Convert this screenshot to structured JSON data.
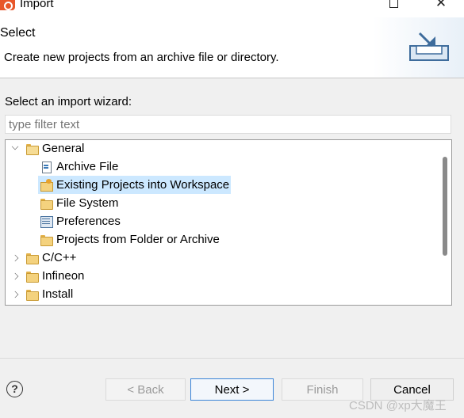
{
  "window": {
    "title": "Import",
    "minimize": "—",
    "close": "✕"
  },
  "header": {
    "title": "Select",
    "description": "Create new projects from an archive file or directory."
  },
  "wizard": {
    "label": "Select an import wizard:",
    "filter_placeholder": "type filter text",
    "tree": [
      {
        "label": "General",
        "expanded": true,
        "level": 0,
        "icon": "folder-open-icon"
      },
      {
        "label": "Archive File",
        "level": 1,
        "icon": "archive-file-icon"
      },
      {
        "label": "Existing Projects into Workspace",
        "level": 1,
        "icon": "project-folder-icon",
        "selected": true
      },
      {
        "label": "File System",
        "level": 1,
        "icon": "folder-icon"
      },
      {
        "label": "Preferences",
        "level": 1,
        "icon": "preferences-icon"
      },
      {
        "label": "Projects from Folder or Archive",
        "level": 1,
        "icon": "folder-icon"
      },
      {
        "label": "C/C++",
        "expanded": false,
        "level": 0,
        "icon": "folder-icon"
      },
      {
        "label": "Infineon",
        "expanded": false,
        "level": 0,
        "icon": "folder-icon"
      },
      {
        "label": "Install",
        "expanded": false,
        "level": 0,
        "icon": "folder-icon"
      }
    ]
  },
  "buttons": {
    "help": "?",
    "back": "< Back",
    "next": "Next >",
    "finish": "Finish",
    "cancel": "Cancel"
  },
  "watermark": "CSDN @xp大魔王"
}
